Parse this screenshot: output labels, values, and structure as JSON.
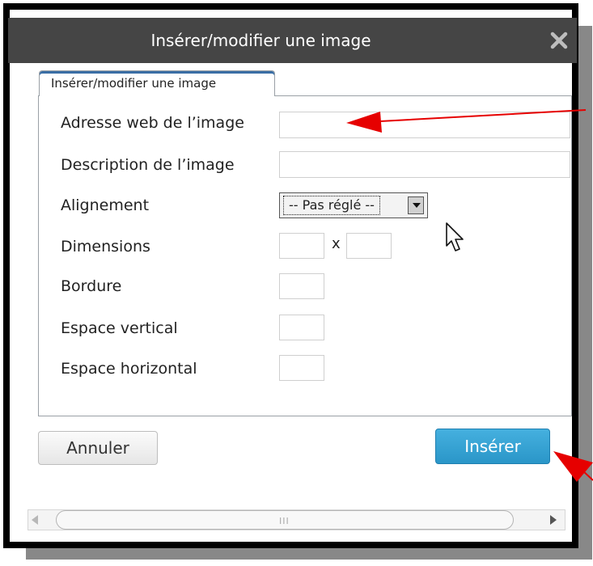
{
  "dialog": {
    "title": "Insérer/modifier une image",
    "close_icon": "close-icon"
  },
  "tab": {
    "label": "Insérer/modifier une image"
  },
  "form": {
    "image_url": {
      "label": "Adresse web de l’image",
      "value": ""
    },
    "description": {
      "label": "Description de l’image",
      "value": ""
    },
    "alignment": {
      "label": "Alignement",
      "selected": "-- Pas réglé --"
    },
    "dimensions": {
      "label": "Dimensions",
      "width": "",
      "height": "",
      "separator": "x"
    },
    "border": {
      "label": "Bordure",
      "value": ""
    },
    "vspace": {
      "label": "Espace vertical",
      "value": ""
    },
    "hspace": {
      "label": "Espace horizontal",
      "value": ""
    }
  },
  "buttons": {
    "cancel": "Annuler",
    "insert": "Insérer"
  },
  "scrollbar": {
    "grip": "III"
  },
  "colors": {
    "titlebar": "#454545",
    "insert_button": "#2a96c8",
    "annotation_arrow": "#e60000"
  },
  "icons": [
    "close-icon",
    "mouse-cursor-icon",
    "annotation-arrow",
    "scroll-left-icon",
    "scroll-right-icon"
  ]
}
